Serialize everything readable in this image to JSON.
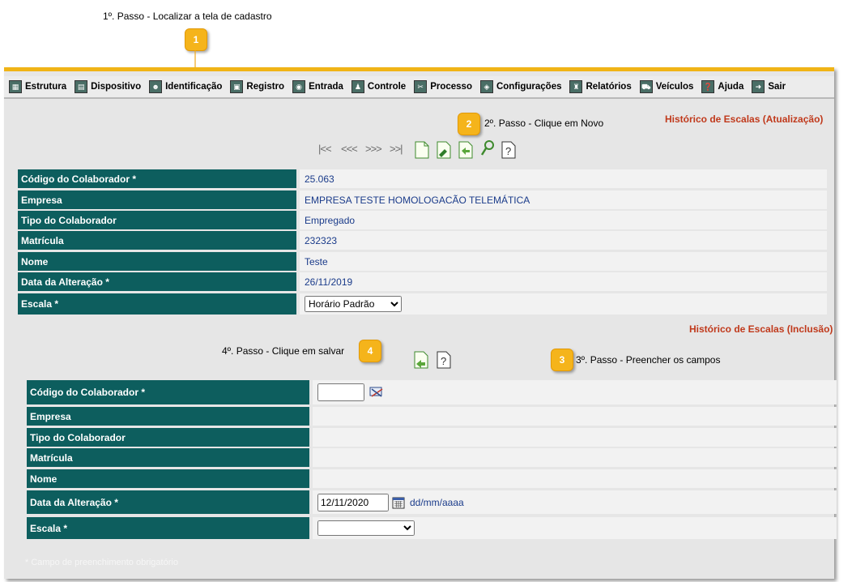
{
  "steps": {
    "step1": "1º. Passo - Localizar a tela de cadastro",
    "step2": "2º. Passo - Clique em Novo",
    "step3": "3º. Passo - Preencher os campos",
    "step4": "4º. Passo - Clique em salvar",
    "badge1": "1",
    "badge2": "2",
    "badge3": "3",
    "badge4": "4"
  },
  "menu": [
    {
      "label": "Estrutura",
      "icon": "structure-icon"
    },
    {
      "label": "Dispositivo",
      "icon": "device-icon"
    },
    {
      "label": "Identificação",
      "icon": "identification-icon"
    },
    {
      "label": "Registro",
      "icon": "register-icon"
    },
    {
      "label": "Entrada",
      "icon": "entry-icon"
    },
    {
      "label": "Controle",
      "icon": "control-icon"
    },
    {
      "label": "Processo",
      "icon": "process-icon"
    },
    {
      "label": "Configurações",
      "icon": "settings-icon"
    },
    {
      "label": "Relatórios",
      "icon": "reports-icon"
    },
    {
      "label": "Veículos",
      "icon": "vehicle-icon"
    },
    {
      "label": "Ajuda",
      "icon": "help-icon"
    },
    {
      "label": "Sair",
      "icon": "exit-icon"
    }
  ],
  "update": {
    "title": "Histórico de Escalas (Atualização)",
    "codigo_label": "Código do Colaborador *",
    "codigo_value": "25.063",
    "empresa_label": "Empresa",
    "empresa_value": "EMPRESA TESTE HOMOLOGACÃO TELEMÁTICA",
    "tipo_label": "Tipo do Colaborador",
    "tipo_value": "Empregado",
    "matricula_label": "Matrícula",
    "matricula_value": "232323",
    "nome_label": "Nome",
    "nome_value": "Teste",
    "data_label": "Data da Alteração *",
    "data_value": "26/11/2019",
    "escala_label": "Escala *",
    "escala_value": "Horário Padrão"
  },
  "insert": {
    "title": "Histórico de Escalas (Inclusão)",
    "codigo_label": "Código do Colaborador *",
    "empresa_label": "Empresa",
    "tipo_label": "Tipo do Colaborador",
    "matricula_label": "Matrícula",
    "nome_label": "Nome",
    "data_label": "Data da Alteração *",
    "data_value": "12/11/2020",
    "date_hint": "dd/mm/aaaa",
    "escala_label": "Escala *"
  },
  "footnote": "* Campo de preenchimento obrigatório",
  "colors": {
    "accent": "#f0b416",
    "label_bg": "#0d5e5e",
    "value_text": "#1a3b8a",
    "title_red": "#c0391b"
  }
}
